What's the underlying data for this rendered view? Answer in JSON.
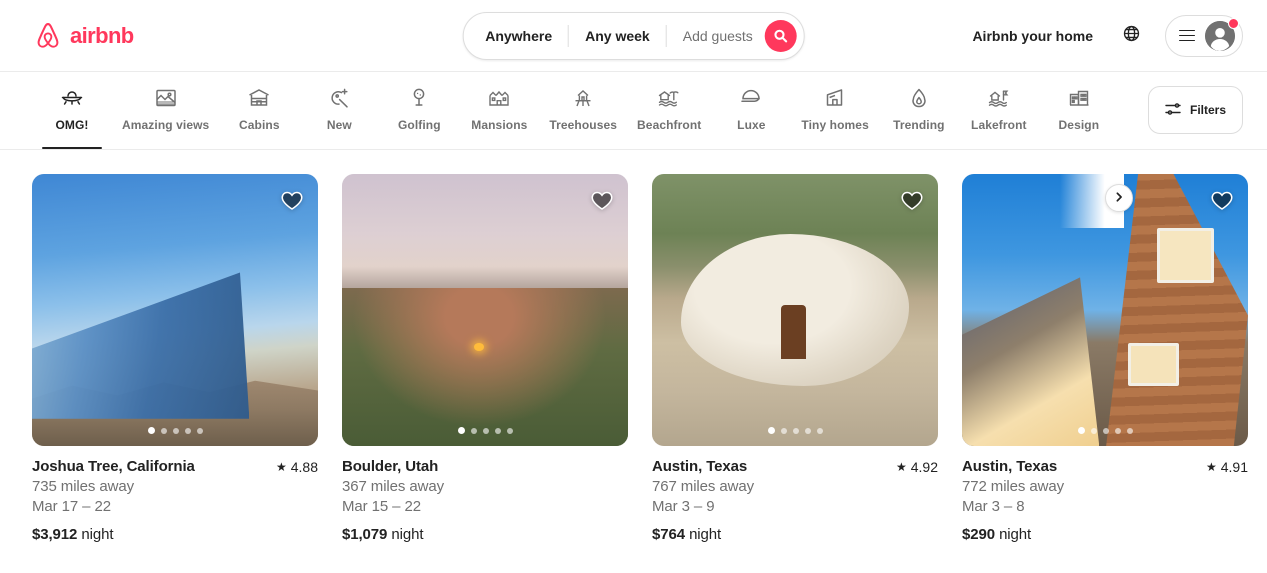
{
  "brand": {
    "name": "airbnb",
    "color": "#FF385C",
    "logo_icon": "airbnb-logo-icon"
  },
  "header": {
    "search": {
      "location_label": "Anywhere",
      "dates_label": "Any week",
      "guests_placeholder": "Add guests",
      "search_icon": "search-icon"
    },
    "host_link": "Airbnb your home",
    "globe_icon": "globe-icon",
    "menu_icon": "hamburger-menu-icon",
    "avatar_icon": "user-avatar-icon",
    "has_notification": true
  },
  "nav": {
    "categories": [
      {
        "label": "OMG!",
        "icon": "ufo-icon",
        "active": true
      },
      {
        "label": "Amazing views",
        "icon": "amazing-views-icon",
        "active": false
      },
      {
        "label": "Cabins",
        "icon": "cabin-icon",
        "active": false
      },
      {
        "label": "New",
        "icon": "new-sparkle-icon",
        "active": false
      },
      {
        "label": "Golfing",
        "icon": "golf-icon",
        "active": false
      },
      {
        "label": "Mansions",
        "icon": "mansion-icon",
        "active": false
      },
      {
        "label": "Treehouses",
        "icon": "treehouse-icon",
        "active": false
      },
      {
        "label": "Beachfront",
        "icon": "beachfront-icon",
        "active": false
      },
      {
        "label": "Luxe",
        "icon": "luxe-icon",
        "active": false
      },
      {
        "label": "Tiny homes",
        "icon": "tiny-home-icon",
        "active": false
      },
      {
        "label": "Trending",
        "icon": "flame-icon",
        "active": false
      },
      {
        "label": "Lakefront",
        "icon": "lakefront-icon",
        "active": false
      },
      {
        "label": "Design",
        "icon": "design-icon",
        "active": false
      }
    ],
    "next_icon": "chevron-right-icon",
    "filters_label": "Filters",
    "filters_icon": "filters-sliders-icon"
  },
  "listings": [
    {
      "title": "Joshua Tree, California",
      "rating": "4.88",
      "distance": "735 miles away",
      "dates": "Mar 17 – 22",
      "price": "$3,912",
      "price_unit": "night",
      "photos": 5,
      "active_photo": 1,
      "favorite_icon": "heart-icon",
      "photo_alt": "mirrored glass house in the desert under blue sky"
    },
    {
      "title": "Boulder, Utah",
      "rating": "",
      "distance": "367 miles away",
      "dates": "Mar 15 – 22",
      "price": "$1,079",
      "price_unit": "night",
      "photos": 5,
      "active_photo": 1,
      "favorite_icon": "heart-icon",
      "photo_alt": "red rock cave dwelling in a valley at dusk"
    },
    {
      "title": "Austin, Texas",
      "rating": "4.92",
      "distance": "767 miles away",
      "dates": "Mar 3 – 9",
      "price": "$764",
      "price_unit": "night",
      "photos": 5,
      "active_photo": 1,
      "favorite_icon": "heart-icon",
      "photo_alt": "white sculptural organic house with a round window"
    },
    {
      "title": "Austin, Texas",
      "rating": "4.91",
      "distance": "772 miles away",
      "dates": "Mar 3 – 8",
      "price": "$290",
      "price_unit": "night",
      "photos": 5,
      "active_photo": 1,
      "favorite_icon": "heart-icon",
      "photo_alt": "angular cedar-shingled house lit at blue hour"
    }
  ],
  "symbols": {
    "star": "★"
  }
}
